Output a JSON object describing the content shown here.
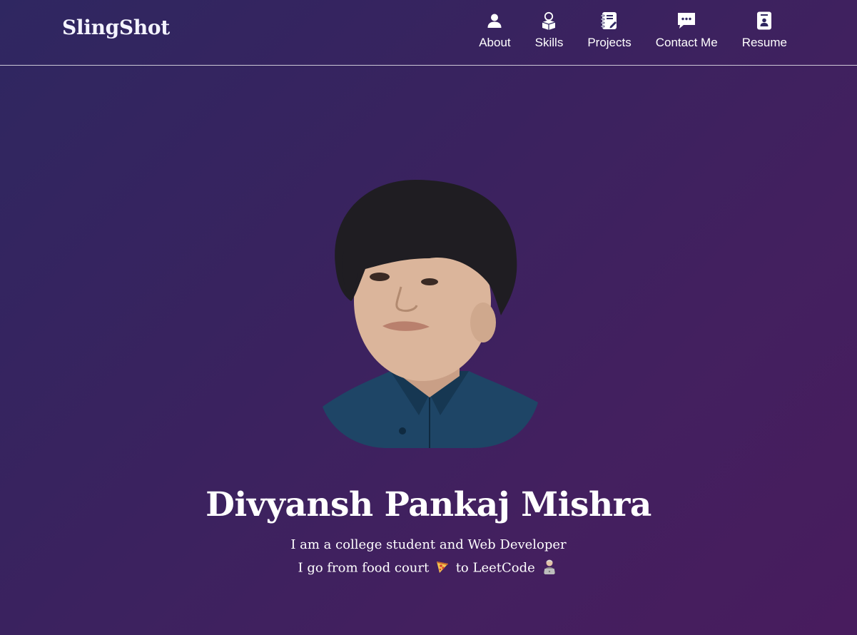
{
  "brand": {
    "name": "SlingShot"
  },
  "nav": {
    "items": [
      {
        "label": "About",
        "icon": "person-icon"
      },
      {
        "label": "Skills",
        "icon": "lightbulb-box-icon"
      },
      {
        "label": "Projects",
        "icon": "notebook-icon"
      },
      {
        "label": "Contact Me",
        "icon": "chat-bubble-icon"
      },
      {
        "label": "Resume",
        "icon": "resume-document-icon"
      }
    ]
  },
  "hero": {
    "name": "Divyansh Pankaj Mishra",
    "line1": "I am a college student and Web Developer",
    "line2_before": "I go from food court",
    "line2_emoji1": "pizza-icon",
    "line2_middle": "to LeetCode",
    "line2_emoji2": "technologist-icon",
    "portrait": "profile-photo"
  },
  "colors": {
    "background_start": "#2f2761",
    "background_end": "#481c5e",
    "text": "#ffffff"
  }
}
